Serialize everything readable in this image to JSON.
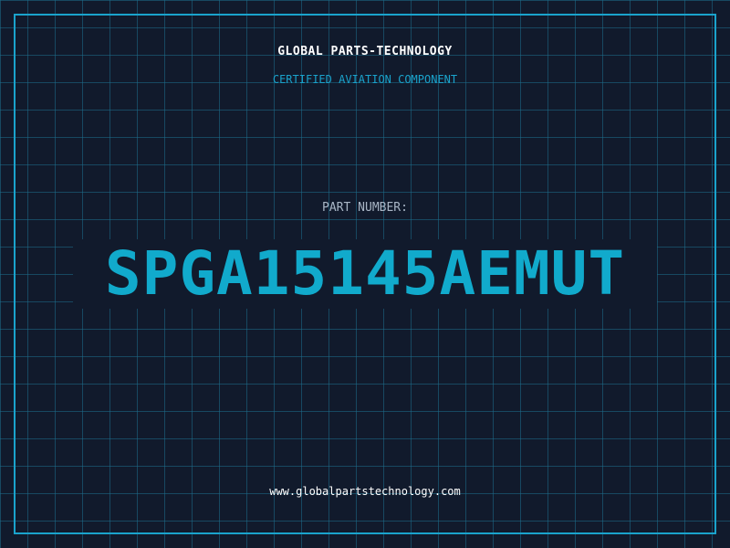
{
  "header": {
    "brand": "GLOBAL PARTS-TECHNOLOGY",
    "subtitle": "CERTIFIED AVIATION COMPONENT"
  },
  "main": {
    "part_label": "PART NUMBER:",
    "part_number": "SPGA15145AEMUT"
  },
  "footer": {
    "website": "www.globalpartstechnology.com"
  },
  "colors": {
    "background": "#111a2c",
    "grid": "#1c6e8c",
    "accent": "#1aa3cc",
    "part_number": "#11aacc",
    "label": "#a9b6c6",
    "text": "#ffffff"
  }
}
